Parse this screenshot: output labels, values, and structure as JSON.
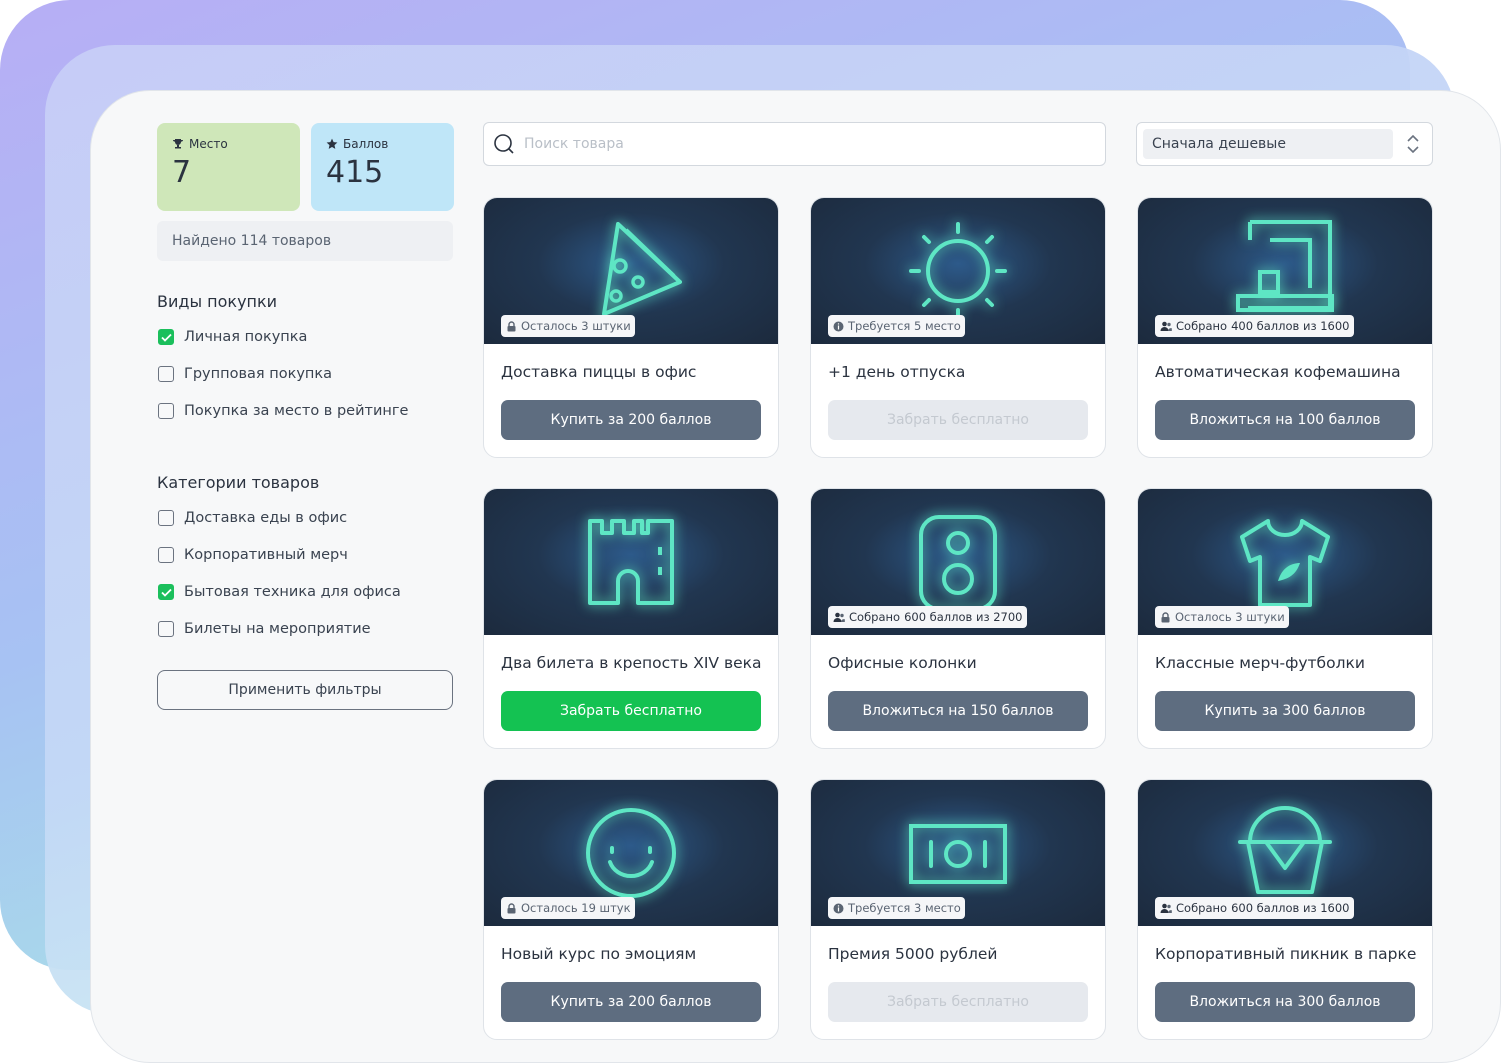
{
  "stats": {
    "place": {
      "label": "Место",
      "value": "7",
      "icon": "trophy-icon"
    },
    "points": {
      "label": "Баллов",
      "value": "415",
      "icon": "star-icon"
    }
  },
  "found_text": "Найдено 114 товаров",
  "filters": {
    "purchase_types": {
      "title": "Виды покупки",
      "items": [
        {
          "label": "Личная покупка",
          "checked": true
        },
        {
          "label": "Групповая покупка",
          "checked": false
        },
        {
          "label": "Покупка за место в рейтинге",
          "checked": false
        }
      ]
    },
    "categories": {
      "title": "Категории товаров",
      "items": [
        {
          "label": "Доставка еды в офис",
          "checked": false
        },
        {
          "label": "Корпоративный мерч",
          "checked": false
        },
        {
          "label": "Бытовая техника для офиса",
          "checked": true
        },
        {
          "label": "Билеты на мероприятие",
          "checked": false
        }
      ]
    },
    "apply_label": "Применить фильтры"
  },
  "search": {
    "placeholder": "Поиск товара",
    "value": ""
  },
  "sort": {
    "selected": "Сначала дешевые"
  },
  "colors": {
    "accent_green": "#14c252",
    "button_gray": "#5e6d80",
    "neon_icon": "#5ee6c4",
    "card_dark": "#1f3047"
  },
  "products": [
    {
      "title": "Доставка пиццы в офис",
      "icon": "pizza-icon",
      "badge_icon": "lock-icon",
      "badge_dark": "",
      "badge_text": "Осталось 3 штуки",
      "button": "Купить за 200 баллов",
      "button_style": "primary"
    },
    {
      "title": "+1 день отпуска",
      "icon": "sun-icon",
      "badge_icon": "info-icon",
      "badge_dark": "",
      "badge_text": "Требуется 5 место",
      "button": "Забрать бесплатно",
      "button_style": "disabled"
    },
    {
      "title": "Автоматическая кофемашина",
      "icon": "coffee-machine-icon",
      "badge_icon": "users-icon",
      "badge_dark": "Собрано",
      "badge_text": "400 баллов из 1600",
      "button": "Вложиться на 100 баллов",
      "button_style": "primary"
    },
    {
      "title": "Два билета в крепость XIV века",
      "icon": "fortress-icon",
      "badge_icon": "",
      "badge_dark": "",
      "badge_text": "",
      "button": "Забрать бесплатно",
      "button_style": "green"
    },
    {
      "title": "Офисные колонки",
      "icon": "speaker-icon",
      "badge_icon": "users-icon",
      "badge_dark": "Собрано",
      "badge_text": "600 баллов из 2700",
      "button": "Вложиться на 150 баллов",
      "button_style": "primary"
    },
    {
      "title": "Классные мерч-футболки",
      "icon": "tshirt-icon",
      "badge_icon": "lock-icon",
      "badge_dark": "",
      "badge_text": "Осталось 3 штуки",
      "button": "Купить за 300 баллов",
      "button_style": "primary"
    },
    {
      "title": "Новый курс по эмоциям",
      "icon": "smile-icon",
      "badge_icon": "lock-icon",
      "badge_dark": "",
      "badge_text": "Осталось 19 штук",
      "button": "Купить за 200 баллов",
      "button_style": "primary"
    },
    {
      "title": "Премия 5000 рублей",
      "icon": "banknote-icon",
      "badge_icon": "info-icon",
      "badge_dark": "",
      "badge_text": "Требуется 3 место",
      "button": "Забрать бесплатно",
      "button_style": "disabled"
    },
    {
      "title": "Корпоративный пикник в парке",
      "icon": "basket-icon",
      "badge_icon": "users-icon",
      "badge_dark": "Собрано",
      "badge_text": "600 баллов из 1600",
      "button": "Вложиться на 300 баллов",
      "button_style": "primary"
    }
  ]
}
